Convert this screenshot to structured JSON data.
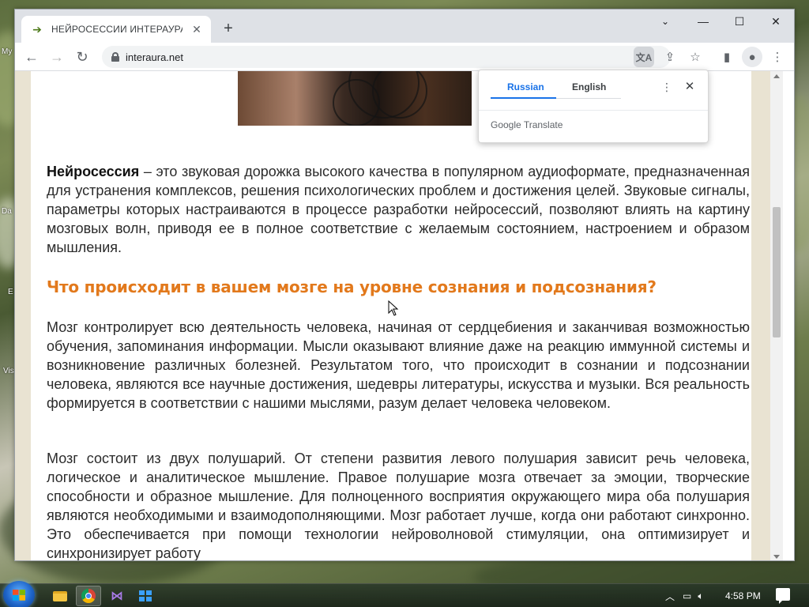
{
  "desktop": {
    "icon_labels": [
      "My",
      "Da",
      "E",
      "Vis"
    ]
  },
  "browser": {
    "tab": {
      "title": "НЕЙРОСЕССИИ ИНТЕРАУРА",
      "favicon": "arrow-icon",
      "close_icon": "close-icon"
    },
    "new_tab_icon": "plus-icon",
    "address": {
      "url": "interaura.net"
    },
    "toolbar_icons": [
      "back-icon",
      "forward-icon",
      "reload-icon",
      "translate-icon",
      "share-icon",
      "star-icon",
      "sidepanel-icon",
      "profile-icon",
      "menu-icon"
    ]
  },
  "article": {
    "para1_bold": "Нейросессия",
    "para1_rest": " – это звуковая дорожка высокого качества в популярном аудиоформате, предназначенная для устранения комплексов, решения психологических проблем и достижения целей. Звуковые сигналы, параметры которых настраиваются в процессе разработки нейросессий, позволяют влиять на картину мозговых волн, приводя ее в полное соответствие с желаемым состоянием, настроением и образом мышления.",
    "heading": "Что происходит в вашем мозге на уровне сознания и подсознания?",
    "para2": "Мозг контролирует всю деятельность человека, начиная от сердцебиения и заканчивая возможностью обучения, запоминания информации. Мысли оказывают влияние даже на реакцию иммунной системы и возникновение различных болезней. Результатом того, что происходит в сознании и подсознании человека, являются все научные достижения, шедевры литературы, искусства и музыки. Вся реальность формируется в соответствии с нашими мыслями, разум делает человека человеком.",
    "para3": "Мозг состоит из двух полушарий. От степени развития левого полушария зависит речь человека, логическое и аналитическое мышление. Правое полушарие мозга отвечает за эмоции, творческие способности и образное мышление. Для полноценного восприятия окружающего мира оба полушария являются необходимыми и взаимодополняющими. Мозг работает лучше, когда они работают синхронно. Это обеспечивается при помощи технологии нейроволновой стимуляции, она оптимизирует и синхронизирует работу",
    "heading_color": "#e2791c"
  },
  "translate_popup": {
    "tab_source": "Russian",
    "tab_target": "English",
    "brand": "Google Translate",
    "accent_color": "#1a73e8"
  },
  "taskbar": {
    "apps": [
      "explorer-icon",
      "chrome-icon",
      "visual-studio-icon",
      "store-icon"
    ],
    "clock": "4:58 PM"
  }
}
